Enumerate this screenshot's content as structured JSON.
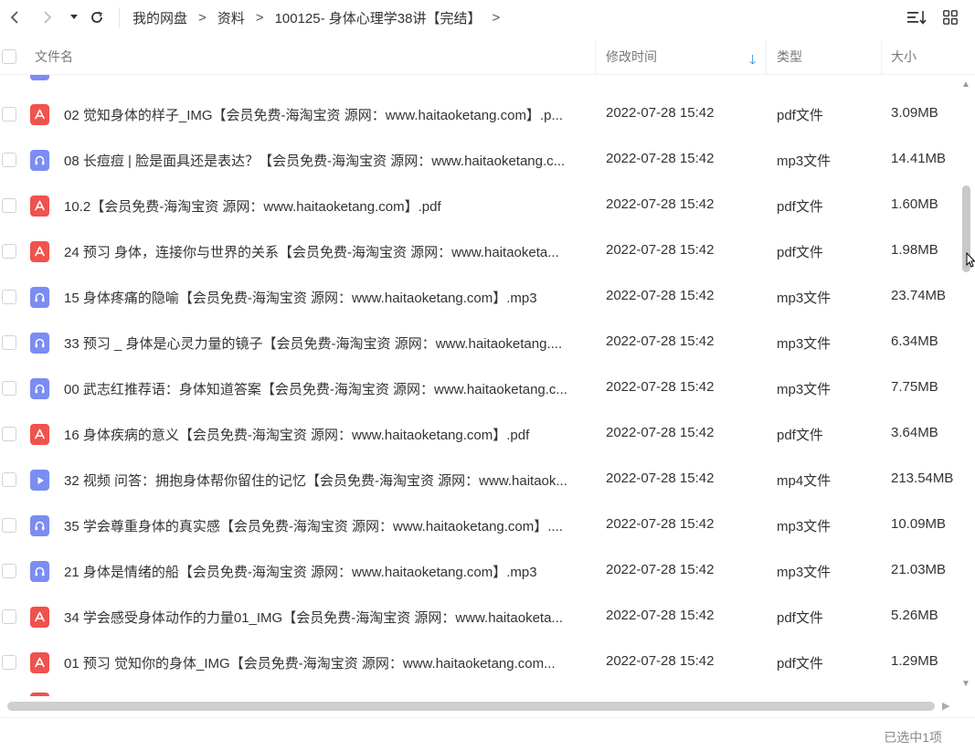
{
  "toolbar": {
    "back_icon": "chevron-left-icon",
    "forward_icon": "chevron-right-icon",
    "dropdown_icon": "caret-down-icon",
    "refresh_icon": "refresh-icon",
    "breadcrumb": [
      "我的网盘",
      "资料",
      "100125- 身体心理学38讲【完结】"
    ],
    "sort_icon": "sort-icon",
    "grid_icon": "grid-view-icon"
  },
  "columns": {
    "name": "文件名",
    "modified": "修改时间",
    "type": "类型",
    "size": "大小"
  },
  "files": [
    {
      "icon": "pdf",
      "name": "02 觉知身体的样子_IMG【会员免费-海淘宝资 源网：www.haitaoketang.com】.p...",
      "modified": "2022-07-28 15:42",
      "type": "pdf文件",
      "size": "3.09MB"
    },
    {
      "icon": "mp3",
      "name": "08 长痘痘 | 脸是面具还是表达？【会员免费-海淘宝资 源网：www.haitaoketang.c...",
      "modified": "2022-07-28 15:42",
      "type": "mp3文件",
      "size": "14.41MB"
    },
    {
      "icon": "pdf",
      "name": "10.2【会员免费-海淘宝资 源网：www.haitaoketang.com】.pdf",
      "modified": "2022-07-28 15:42",
      "type": "pdf文件",
      "size": "1.60MB"
    },
    {
      "icon": "pdf",
      "name": "24 预习  身体，连接你与世界的关系【会员免费-海淘宝资 源网：www.haitaoketa...",
      "modified": "2022-07-28 15:42",
      "type": "pdf文件",
      "size": "1.98MB"
    },
    {
      "icon": "mp3",
      "name": "15 身体疼痛的隐喻【会员免费-海淘宝资 源网：www.haitaoketang.com】.mp3",
      "modified": "2022-07-28 15:42",
      "type": "mp3文件",
      "size": "23.74MB"
    },
    {
      "icon": "mp3",
      "name": "33 预习 _ 身体是心灵力量的镜子【会员免费-海淘宝资 源网：www.haitaoketang....",
      "modified": "2022-07-28 15:42",
      "type": "mp3文件",
      "size": "6.34MB"
    },
    {
      "icon": "mp3",
      "name": "00 武志红推荐语：身体知道答案【会员免费-海淘宝资 源网：www.haitaoketang.c...",
      "modified": "2022-07-28 15:42",
      "type": "mp3文件",
      "size": "7.75MB"
    },
    {
      "icon": "pdf",
      "name": "16 身体疾病的意义【会员免费-海淘宝资 源网：www.haitaoketang.com】.pdf",
      "modified": "2022-07-28 15:42",
      "type": "pdf文件",
      "size": "3.64MB"
    },
    {
      "icon": "mp4",
      "name": "32 视频 问答：拥抱身体帮你留住的记忆【会员免费-海淘宝资 源网：www.haitaok...",
      "modified": "2022-07-28 15:42",
      "type": "mp4文件",
      "size": "213.54MB"
    },
    {
      "icon": "mp3",
      "name": "35 学会尊重身体的真实感【会员免费-海淘宝资 源网：www.haitaoketang.com】....",
      "modified": "2022-07-28 15:42",
      "type": "mp3文件",
      "size": "10.09MB"
    },
    {
      "icon": "mp3",
      "name": "21 身体是情绪的船【会员免费-海淘宝资 源网：www.haitaoketang.com】.mp3",
      "modified": "2022-07-28 15:42",
      "type": "mp3文件",
      "size": "21.03MB"
    },
    {
      "icon": "pdf",
      "name": "34 学会感受身体动作的力量01_IMG【会员免费-海淘宝资 源网：www.haitaoketa...",
      "modified": "2022-07-28 15:42",
      "type": "pdf文件",
      "size": "5.26MB"
    },
    {
      "icon": "pdf",
      "name": "01 预习  觉知你的身体_IMG【会员免费-海淘宝资 源网：www.haitaoketang.com...",
      "modified": "2022-07-28 15:42",
      "type": "pdf文件",
      "size": "1.29MB"
    }
  ],
  "status": "已选中1项",
  "colors": {
    "pdf": "#f0524d",
    "audio": "#7b8cf3",
    "sort_arrow": "#1e88e5"
  }
}
